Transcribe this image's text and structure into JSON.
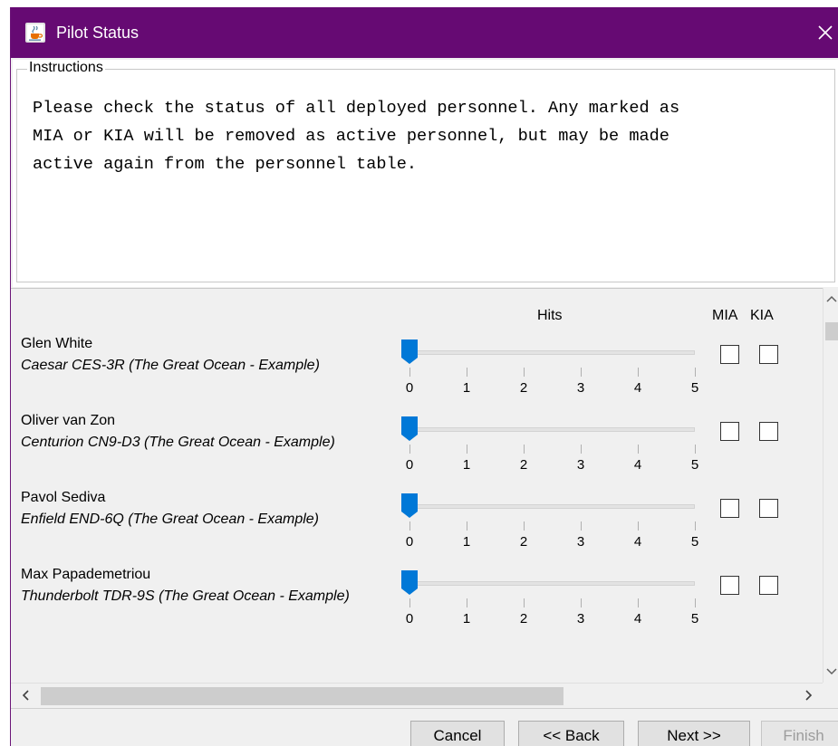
{
  "window": {
    "title": "Pilot Status",
    "app_icon": "java-cup-icon",
    "close_icon": "close-icon"
  },
  "instructions": {
    "legend": "Instructions",
    "text": "Please check the status of all deployed personnel. Any marked as\nMIA or KIA will be removed as active personnel, but may be made\nactive again from the personnel table."
  },
  "columns": {
    "hits": "Hits",
    "mia": "MIA",
    "kia": "KIA"
  },
  "tick_labels": [
    "0",
    "1",
    "2",
    "3",
    "4",
    "5"
  ],
  "pilots": [
    {
      "name": "Glen White",
      "unit": "Caesar CES-3R (The Great Ocean - Example)",
      "hits": 0,
      "mia": false,
      "kia": false
    },
    {
      "name": "Oliver van Zon",
      "unit": "Centurion CN9-D3 (The Great Ocean - Example)",
      "hits": 0,
      "mia": false,
      "kia": false
    },
    {
      "name": "Pavol Sediva",
      "unit": "Enfield END-6Q (The Great Ocean - Example)",
      "hits": 0,
      "mia": false,
      "kia": false
    },
    {
      "name": "Max Papademetriou",
      "unit": "Thunderbolt TDR-9S (The Great Ocean - Example)",
      "hits": 0,
      "mia": false,
      "kia": false
    }
  ],
  "buttons": {
    "cancel": "Cancel",
    "back": "<< Back",
    "next": "Next >>",
    "finish": "Finish"
  },
  "colors": {
    "titlebar": "#660a73",
    "slider_thumb": "#0078d7"
  }
}
